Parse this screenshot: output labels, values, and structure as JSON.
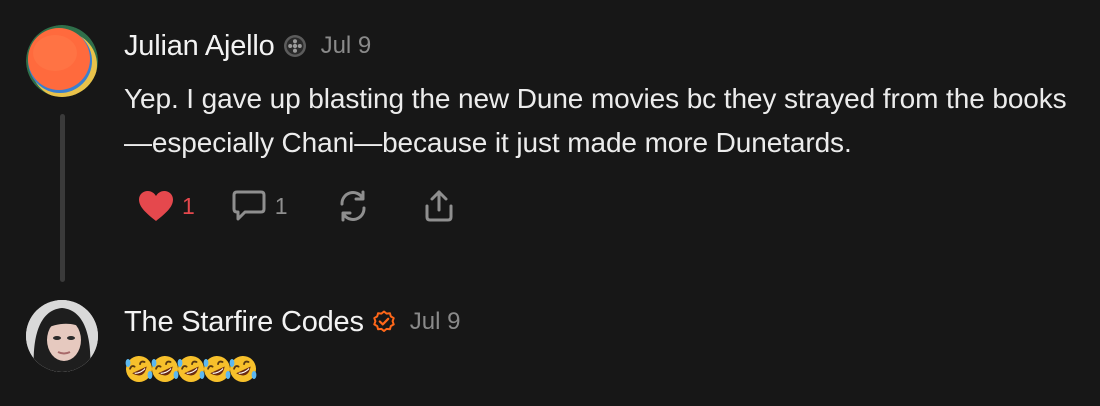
{
  "comments": [
    {
      "author": "Julian Ajello",
      "date": "Jul 9",
      "badge_icon": "subscriber-badge-icon",
      "text": "Yep. I gave up blasting the new Dune movies bc they strayed from the books—especially Chani—because it just made more Dunetards.",
      "likes": "1",
      "replies": "1",
      "liked": true
    },
    {
      "author": "The Starfire Codes",
      "date": "Jul 9",
      "badge_icon": "verified-check-icon",
      "emoji_count": 5,
      "emoji_icon": "rolling-on-floor-laughing-emoji"
    }
  ],
  "colors": {
    "background": "#171717",
    "like_red": "#e5484d",
    "verified_orange": "#ff6719",
    "muted_text": "#8a8a8a"
  }
}
